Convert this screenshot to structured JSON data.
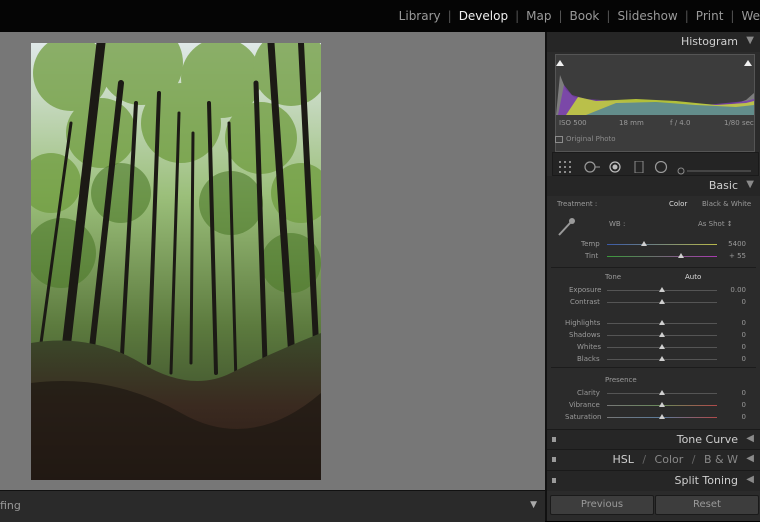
{
  "modules": [
    "Library",
    "Develop",
    "Map",
    "Book",
    "Slideshow",
    "Print",
    "We"
  ],
  "active_module": "Develop",
  "filmstrip": {
    "label": "fing"
  },
  "histogram": {
    "title": "Histogram",
    "iso": "ISO 500",
    "focal": "18 mm",
    "aperture": "f / 4.0",
    "shutter": "1/80 sec",
    "original_photo": "Original Photo"
  },
  "basic": {
    "title": "Basic",
    "treatment_label": "Treatment :",
    "treatment_color": "Color",
    "treatment_bw": "Black & White",
    "wb_label": "WB :",
    "wb_value": "As Shot ↕",
    "temp_label": "Temp",
    "temp_value": "5400",
    "tint_label": "Tint",
    "tint_value": "+ 55",
    "tone_label": "Tone",
    "auto_label": "Auto",
    "exposure_label": "Exposure",
    "exposure_value": "0.00",
    "contrast_label": "Contrast",
    "contrast_value": "0",
    "highlights_label": "Highlights",
    "highlights_value": "0",
    "shadows_label": "Shadows",
    "shadows_value": "0",
    "whites_label": "Whites",
    "whites_value": "0",
    "blacks_label": "Blacks",
    "blacks_value": "0",
    "presence_label": "Presence",
    "clarity_label": "Clarity",
    "clarity_value": "0",
    "vibrance_label": "Vibrance",
    "vibrance_value": "0",
    "saturation_label": "Saturation",
    "saturation_value": "0"
  },
  "panels": {
    "tone_curve": "Tone Curve",
    "hsl": "HSL",
    "color": "Color",
    "bw": "B & W",
    "split_toning": "Split Toning",
    "slash": "/"
  },
  "buttons": {
    "previous": "Previous",
    "reset": "Reset"
  }
}
